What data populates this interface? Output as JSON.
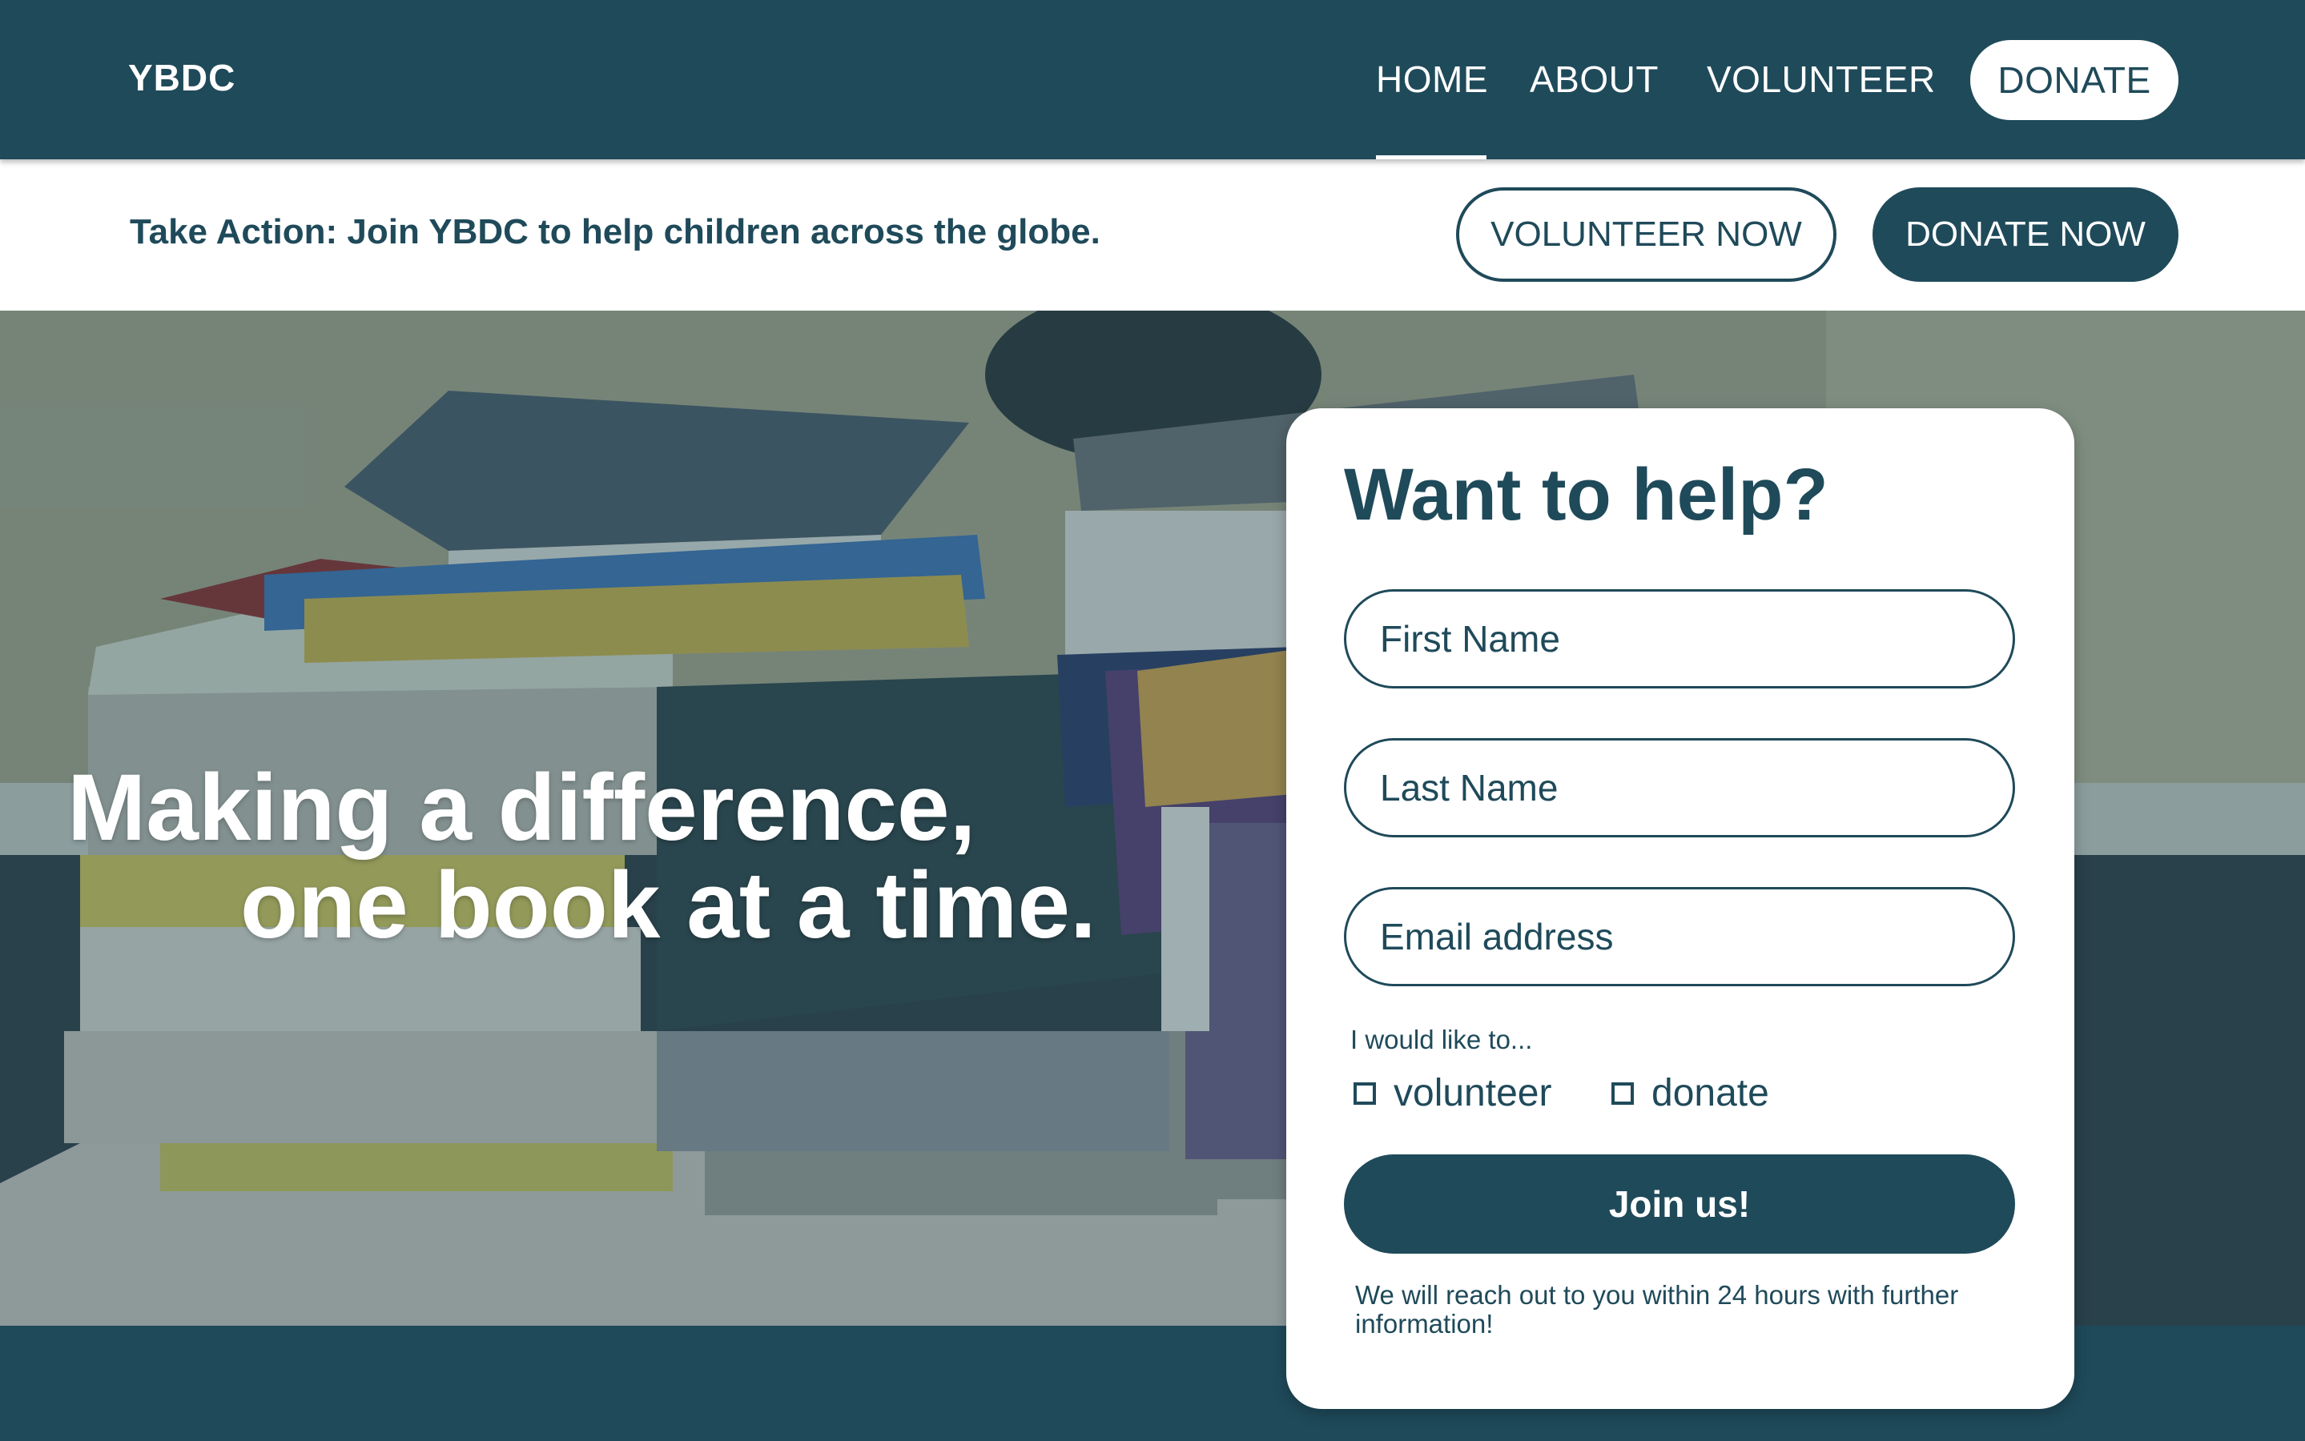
{
  "header": {
    "logo": "YBDC",
    "nav": [
      {
        "label": "HOME",
        "active": true
      },
      {
        "label": "ABOUT"
      },
      {
        "label": "VOLUNTEER"
      }
    ],
    "donate_label": "DONATE"
  },
  "action_bar": {
    "text": "Take Action: Join YBDC to help children across the globe.",
    "volunteer_label": "VOLUNTEER NOW",
    "donate_label": "DONATE NOW"
  },
  "hero": {
    "line1": "Making a difference,",
    "line2": "one book at a time."
  },
  "form": {
    "title": "Want to help?",
    "first_name_placeholder": "First Name",
    "last_name_placeholder": "Last Name",
    "email_placeholder": "Email address",
    "options_label": "I would like to...",
    "option_volunteer": "volunteer",
    "option_donate": "donate",
    "submit_label": "Join us!",
    "note": "We will reach out to you within 24 hours with further information!"
  },
  "colors": {
    "primary": "#1f4a5a",
    "white": "#ffffff"
  }
}
